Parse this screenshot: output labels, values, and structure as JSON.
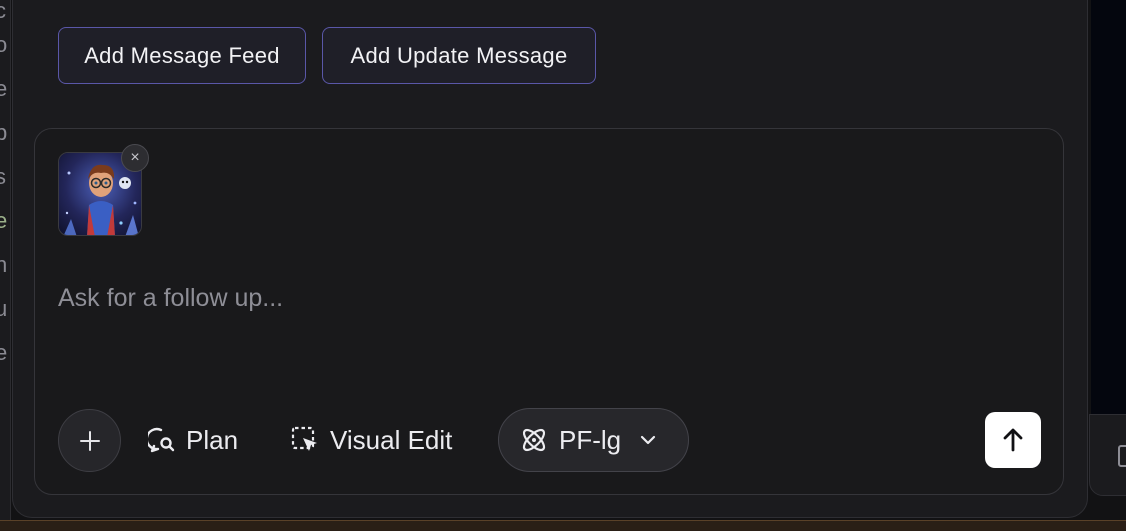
{
  "buttons": {
    "add_message_feed": "Add Message Feed",
    "add_update_message": "Add Update Message"
  },
  "composer": {
    "placeholder": "Ask for a follow up...",
    "value": "",
    "attachment_remove": "×",
    "plan_label": "Plan",
    "visual_edit_label": "Visual Edit",
    "model_label": "PF-lg"
  },
  "icons": {
    "attach": "plus-icon",
    "plan": "chat-search-icon",
    "visual_edit": "dashed-select-cursor-icon",
    "model": "atom-icon",
    "model_dropdown": "chevron-down-icon",
    "send": "arrow-up-icon"
  },
  "colors": {
    "accent_border": "#5a57a8",
    "background": "#1b1b1e",
    "send_button": "#ffffff"
  }
}
